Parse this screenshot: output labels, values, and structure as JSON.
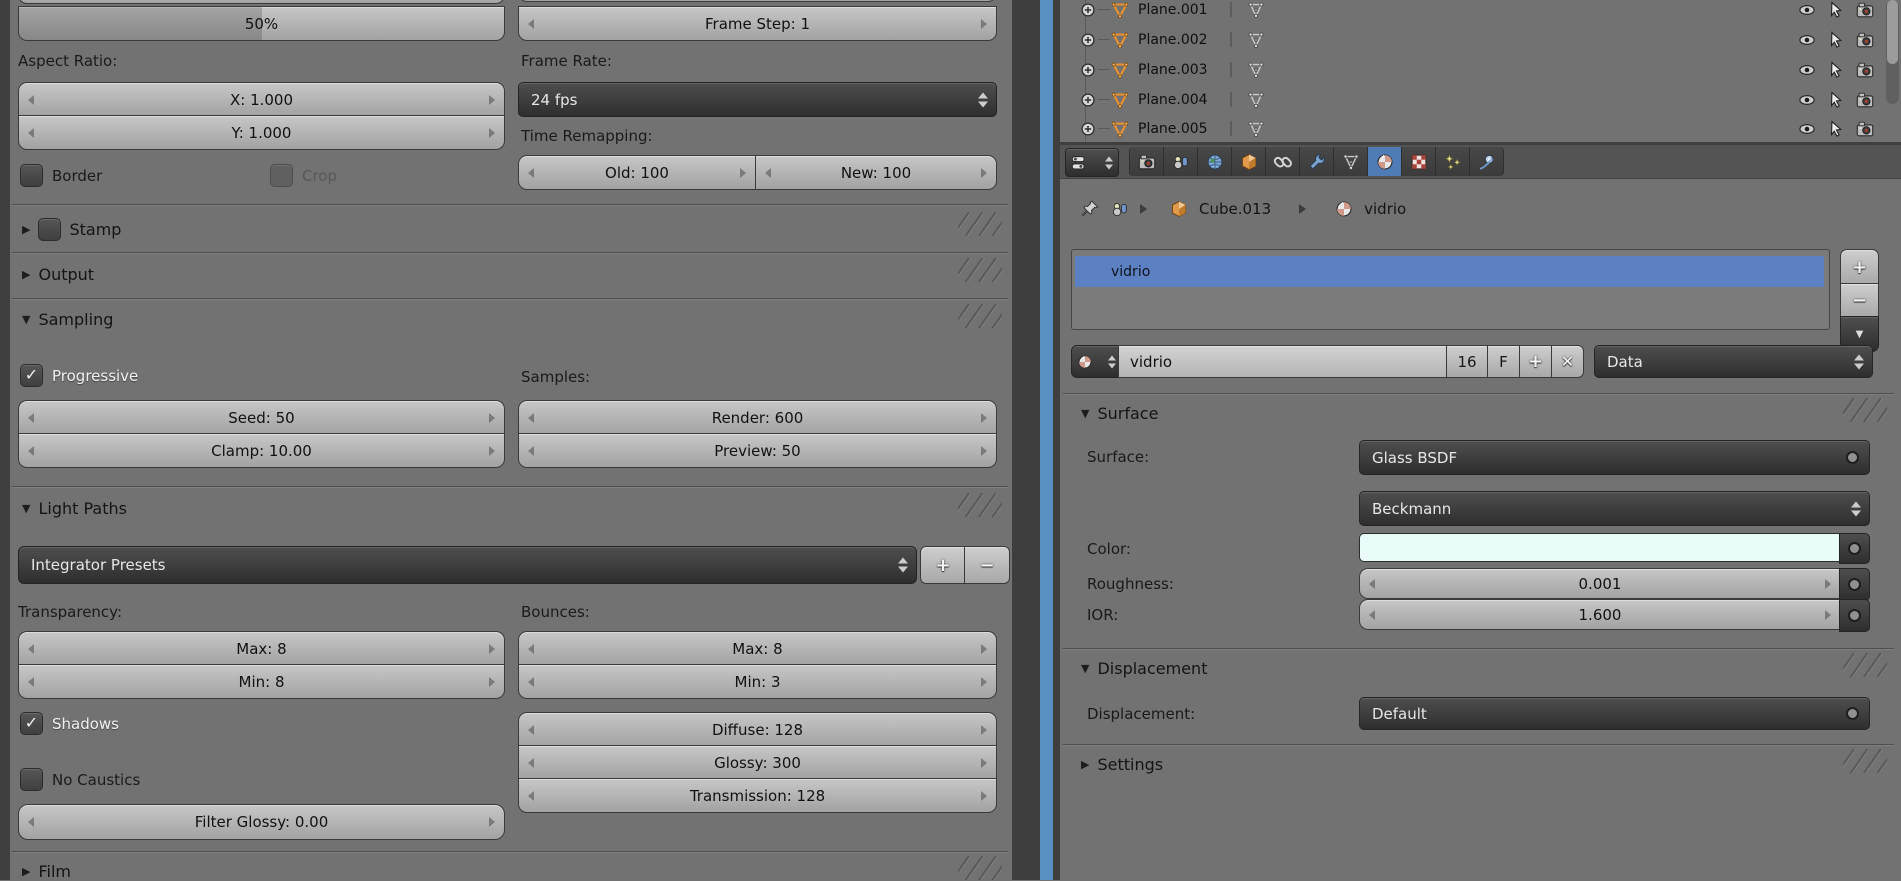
{
  "left_panel": {
    "resolution_percent": "50%",
    "aspect_ratio_label": "Aspect Ratio:",
    "aspect_x": "X: 1.000",
    "aspect_y": "Y: 1.000",
    "border_label": "Border",
    "crop_label": "Crop",
    "frame_step": "Frame Step: 1",
    "frame_rate_label": "Frame Rate:",
    "frame_rate_value": "24 fps",
    "time_remapping_label": "Time Remapping:",
    "old_value": "Old: 100",
    "new_value": "New: 100",
    "stamp_header": "Stamp",
    "output_header": "Output",
    "sampling_header": "Sampling",
    "progressive_label": "Progressive",
    "samples_label": "Samples:",
    "seed": "Seed: 50",
    "clamp": "Clamp: 10.00",
    "render_samples": "Render: 600",
    "preview_samples": "Preview: 50",
    "light_paths_header": "Light Paths",
    "integrator_presets": "Integrator Presets",
    "transparency_label": "Transparency:",
    "bounces_label": "Bounces:",
    "transparency_max": "Max: 8",
    "transparency_min": "Min: 8",
    "bounces_max": "Max: 8",
    "bounces_min": "Min: 3",
    "shadows_label": "Shadows",
    "no_caustics_label": "No Caustics",
    "diffuse": "Diffuse: 128",
    "glossy": "Glossy: 300",
    "transmission": "Transmission: 128",
    "filter_glossy": "Filter Glossy: 0.00",
    "film_header": "Film"
  },
  "outliner": {
    "items": [
      {
        "name": "Plane.001"
      },
      {
        "name": "Plane.002"
      },
      {
        "name": "Plane.003"
      },
      {
        "name": "Plane.004"
      },
      {
        "name": "Plane.005"
      }
    ]
  },
  "properties": {
    "tabs": [
      "render",
      "scene",
      "world",
      "object",
      "constraints",
      "modifiers",
      "object-data",
      "material",
      "texture",
      "particles",
      "physics"
    ],
    "active_tab": "material",
    "breadcrumb": {
      "object": "Cube.013",
      "material": "vidrio"
    },
    "material_list": {
      "selected_slot": "vidrio"
    },
    "name_row": {
      "name_value": "vidrio",
      "users_count": "16",
      "fake_user": "F"
    },
    "datablock_source": "Data",
    "surface_panel": {
      "header": "Surface",
      "surface_label": "Surface:",
      "surface_value": "Glass BSDF",
      "distribution_value": "Beckmann",
      "color_label": "Color:",
      "color_hex": "#e9fcfa",
      "roughness_label": "Roughness:",
      "roughness_value": "0.001",
      "ior_label": "IOR:",
      "ior_value": "1.600"
    },
    "displacement_panel": {
      "header": "Displacement",
      "label": "Displacement:",
      "value": "Default"
    },
    "settings_header": "Settings"
  },
  "colors": {
    "panel_bg": "#727272",
    "divider_blue": "#5a8fc4",
    "selection_blue": "#5b81c3",
    "active_tab_blue": "#4f7cb5",
    "glass_color_swatch": "#e9fcfa"
  }
}
